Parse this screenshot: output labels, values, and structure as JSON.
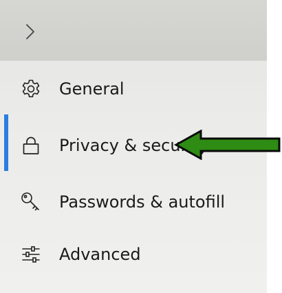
{
  "colors": {
    "accent": "#2a7de1",
    "arrow_fill": "#2e8b14",
    "arrow_stroke": "#0a0a0a"
  },
  "expand_button": {
    "icon": "chevron-right-icon"
  },
  "nav": {
    "items": [
      {
        "label": "General",
        "icon": "gear-icon",
        "selected": false
      },
      {
        "label": "Privacy & security",
        "icon": "lock-icon",
        "selected": true
      },
      {
        "label": "Passwords & autofill",
        "icon": "key-icon",
        "selected": false
      },
      {
        "label": "Advanced",
        "icon": "sliders-icon",
        "selected": false
      }
    ]
  },
  "annotation": {
    "icon": "green-arrow-icon",
    "points_to": "Privacy & security"
  }
}
